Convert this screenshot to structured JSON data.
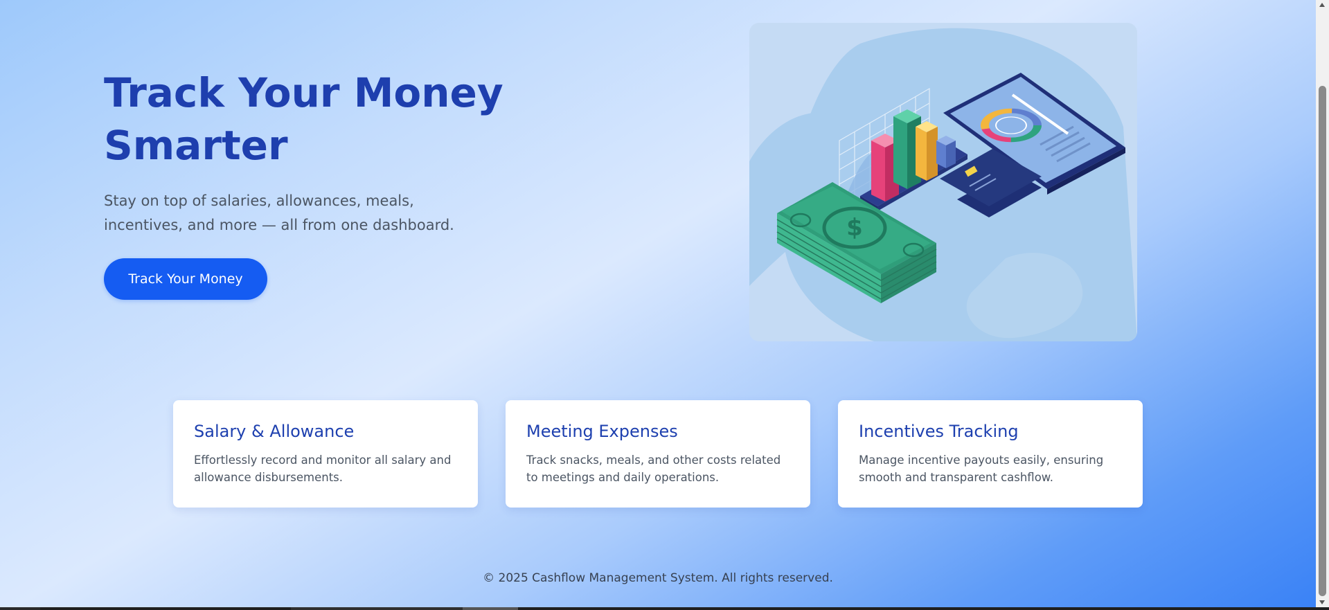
{
  "hero": {
    "title": "Track Your Money Smarter",
    "subtitle": "Stay on top of salaries, allowances, meals, incentives, and more — all from one dashboard.",
    "cta_label": "Track Your Money"
  },
  "illustration": {
    "subject": "finance-isometric-illustration"
  },
  "features": [
    {
      "title": "Salary & Allowance",
      "description": "Effortlessly record and monitor all salary and allowance disbursements."
    },
    {
      "title": "Meeting Expenses",
      "description": "Track snacks, meals, and other costs related to meetings and daily operations."
    },
    {
      "title": "Incentives Tracking",
      "description": "Manage incentive payouts easily, ensuring smooth and transparent cashflow."
    }
  ],
  "footer": {
    "text": "© 2025 Cashflow Management System. All rights reserved."
  },
  "colors": {
    "accent": "#155cf2",
    "heading": "#1e3fae",
    "card_heading": "#1e40af"
  }
}
